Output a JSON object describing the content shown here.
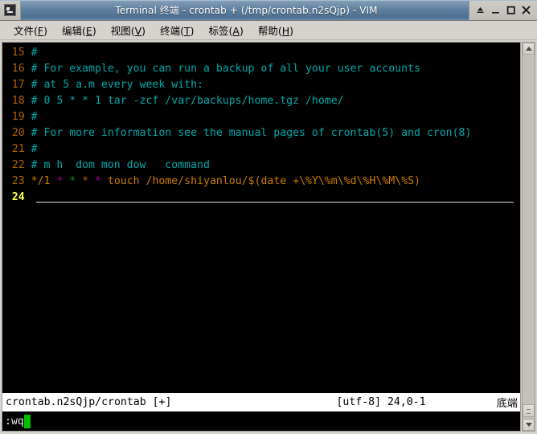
{
  "window": {
    "title": "Terminal 终端 - crontab + (/tmp/crontab.n2sQjp) - VIM",
    "icon": "terminal-icon",
    "buttons": {
      "shade": "▲",
      "minimize": "▁",
      "maximize": "◻",
      "close": "✕"
    }
  },
  "menubar": {
    "items": [
      {
        "label": "文件",
        "accel": "F"
      },
      {
        "label": "编辑",
        "accel": "E"
      },
      {
        "label": "视图",
        "accel": "V"
      },
      {
        "label": "终端",
        "accel": "T"
      },
      {
        "label": "标签",
        "accel": "A"
      },
      {
        "label": "帮助",
        "accel": "H"
      }
    ]
  },
  "editor": {
    "lines": [
      {
        "num": "15",
        "text": "#"
      },
      {
        "num": "16",
        "text": "# For example, you can run a backup of all your user accounts"
      },
      {
        "num": "17",
        "text": "# at 5 a.m every week with:"
      },
      {
        "num": "18",
        "text": "# 0 5 * * 1 tar -zcf /var/backups/home.tgz /home/"
      },
      {
        "num": "19",
        "text": "#"
      },
      {
        "num": "20",
        "text": "# For more information see the manual pages of crontab(5) and cron(8)"
      },
      {
        "num": "21",
        "text": "#"
      },
      {
        "num": "22",
        "text": "# m h  dom mon dow   command"
      },
      {
        "num": "23",
        "text": "*/1 * * * * touch /home/shiyanlou/$(date +\\%Y\\%m\\%d\\%H\\%M\\%S)"
      },
      {
        "num": "24",
        "text": ""
      }
    ],
    "cron_line": {
      "schedule_first": "*/1",
      "star2": "*",
      "star3": "*",
      "star4": "*",
      "star5": "*",
      "command": "touch /home/shiyanlou/$(date +\\%Y\\%m\\%d\\%H\\%M\\%S)"
    },
    "current_line": "24"
  },
  "statusline": {
    "file": "crontab.n2sQjp/crontab [+]",
    "encoding_pos": "[utf-8] 24,0-1",
    "position_label": "底端"
  },
  "cmdline": {
    "text": ":wq",
    "cursor": "block"
  },
  "colors": {
    "terminal_bg": "#000000",
    "line_number": "#b06000",
    "current_line_number": "#ffff44",
    "comment": "#00a8a8",
    "command_text": "#cc7a00",
    "star_magenta": "#a000a0",
    "star_green": "#00a000",
    "star_orange": "#b06000",
    "statusline_bg": "#ffffff",
    "statusline_fg": "#000000",
    "cursor": "#00c000",
    "titlebar": "#5d7e9e",
    "chrome": "#d6d3ce"
  }
}
